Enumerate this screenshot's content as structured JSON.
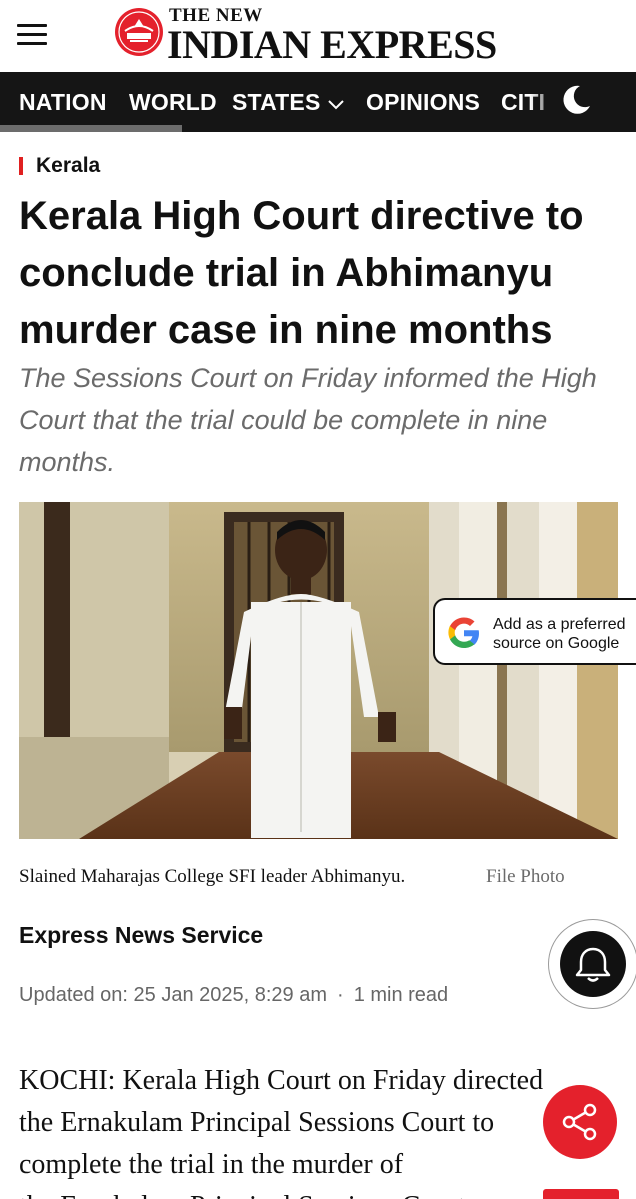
{
  "header": {
    "logo_small": "THE NEW",
    "logo_big": "INDIAN EXPRESS"
  },
  "nav": {
    "items": [
      {
        "label": "NATION"
      },
      {
        "label": "WORLD"
      },
      {
        "label": "STATES"
      },
      {
        "label": "OPINIONS"
      },
      {
        "label": "CITI"
      }
    ],
    "active": "NATION"
  },
  "article": {
    "category": "Kerala",
    "headline": "Kerala High Court directive to conclude trial in Abhimanyu murder case in nine months",
    "standfirst": "The Sessions Court on Friday informed the High Court that the trial could be complete in nine months.",
    "google_pill": "Add as a preferred source on Google",
    "caption": "Slained Maharajas College SFI leader Abhimanyu.",
    "credit": "File Photo",
    "byline": "Express News Service",
    "updated": "Updated on: 25 Jan 2025, 8:29 am",
    "dot": "·",
    "read_time": "1 min read",
    "body_lines": [
      "KOCHI: Kerala High Court on Friday directed",
      "the Ernakulam Principal Sessions Court to",
      "complete the trial in the murder of",
      "the Ernakulam Principal Sessions Court"
    ]
  },
  "colors": {
    "brand_red": "#e4212c",
    "nav_bg": "#151515",
    "accent": "#e02020"
  },
  "icons": [
    "menu-icon",
    "moon-icon",
    "google-icon",
    "bell-icon",
    "share-icon"
  ]
}
